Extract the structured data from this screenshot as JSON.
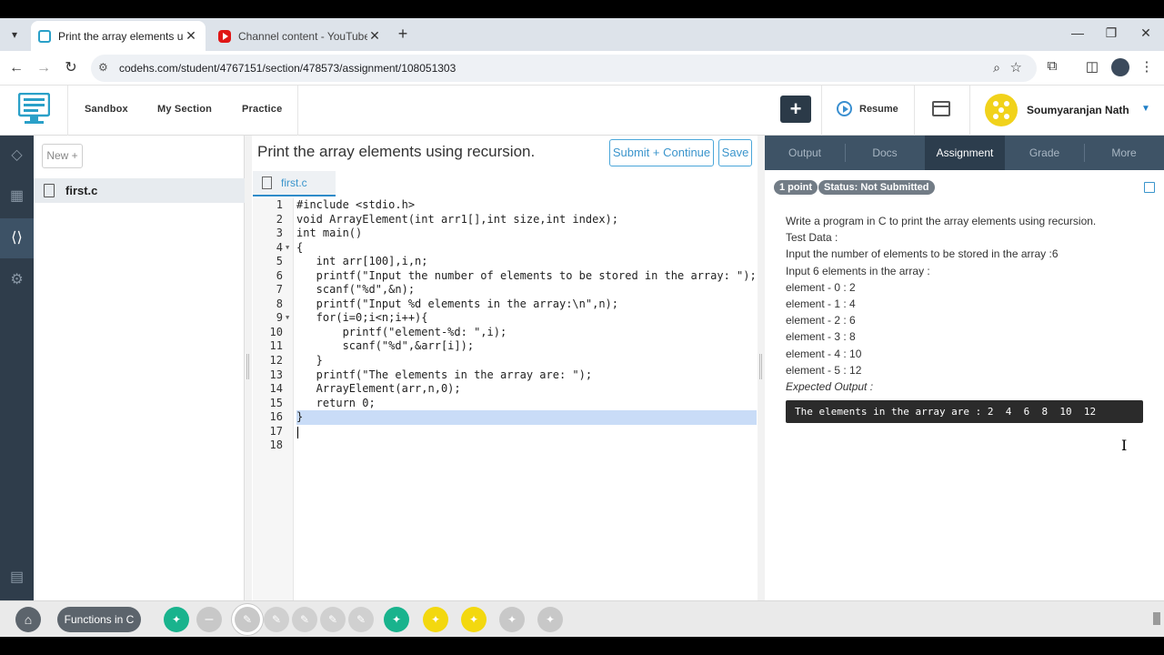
{
  "browser": {
    "tabs": [
      {
        "title": "Print the array elements using r",
        "active": true
      },
      {
        "title": "Channel content - YouTube Stu",
        "active": false
      }
    ],
    "url": "codehs.com/student/4767151/section/478573/assignment/108051303"
  },
  "header": {
    "nav": [
      "Sandbox",
      "My Section",
      "Practice"
    ],
    "resume_label": "Resume",
    "username": "Soumyaranjan Nath"
  },
  "files": {
    "new_label": "New +",
    "items": [
      "first.c"
    ]
  },
  "editor": {
    "title": "Print the array elements using recursion.",
    "submit_label": "Submit + Continue",
    "save_label": "Save",
    "tab_name": "first.c",
    "lines": [
      "#include <stdio.h>",
      "void ArrayElement(int arr1[],int size,int index);",
      "int main()",
      "{",
      "   int arr[100],i,n;",
      "   printf(\"Input the number of elements to be stored in the array: \");",
      "   scanf(\"%d\",&n);",
      "   printf(\"Input %d elements in the array:\\n\",n);",
      "   for(i=0;i<n;i++){",
      "       printf(\"element-%d: \",i);",
      "       scanf(\"%d\",&arr[i]);",
      "   }",
      "   printf(\"The elements in the array are: \");",
      "   ArrayElement(arr,n,0);",
      "   return 0;",
      "}",
      "",
      ""
    ],
    "line_numbers": [
      "1",
      "2",
      "3",
      "4",
      "5",
      "6",
      "7",
      "8",
      "9",
      "10",
      "11",
      "12",
      "13",
      "14",
      "15",
      "16",
      "17",
      "18"
    ]
  },
  "right_panel": {
    "tabs": [
      "Output",
      "Docs",
      "Assignment",
      "Grade",
      "More"
    ],
    "active_tab": "Assignment",
    "badges": {
      "points": "1 point",
      "status": "Status: Not Submitted"
    },
    "assignment_lines": [
      "Write a program in C to print the array elements using recursion.",
      "Test Data :",
      "Input the number of elements to be stored in the array :6",
      "Input 6 elements in the array :",
      "element - 0 : 2",
      "element - 1 : 4",
      "element - 2 : 6",
      "element - 3 : 8",
      "element - 4 : 10",
      "element - 5 : 12"
    ],
    "expected_label": "Expected Output :",
    "expected_output": "The elements in the array are : 2  4  6  8  10  12"
  },
  "bottom": {
    "module_label": "Functions in C",
    "collapse_symbol": "–"
  },
  "colors": {
    "rail": "#2f3d4b",
    "accent": "#3b95cc",
    "teal": "#19b38d",
    "yellow": "#f3d80f"
  },
  "icons": {
    "tab_menu": "chevron-down-icon",
    "back": "arrow-left-icon",
    "forward": "arrow-right-icon",
    "reload": "reload-icon",
    "lightbulb": "lightbulb-icon",
    "pencil": "pencil-icon",
    "home": "home-icon"
  }
}
